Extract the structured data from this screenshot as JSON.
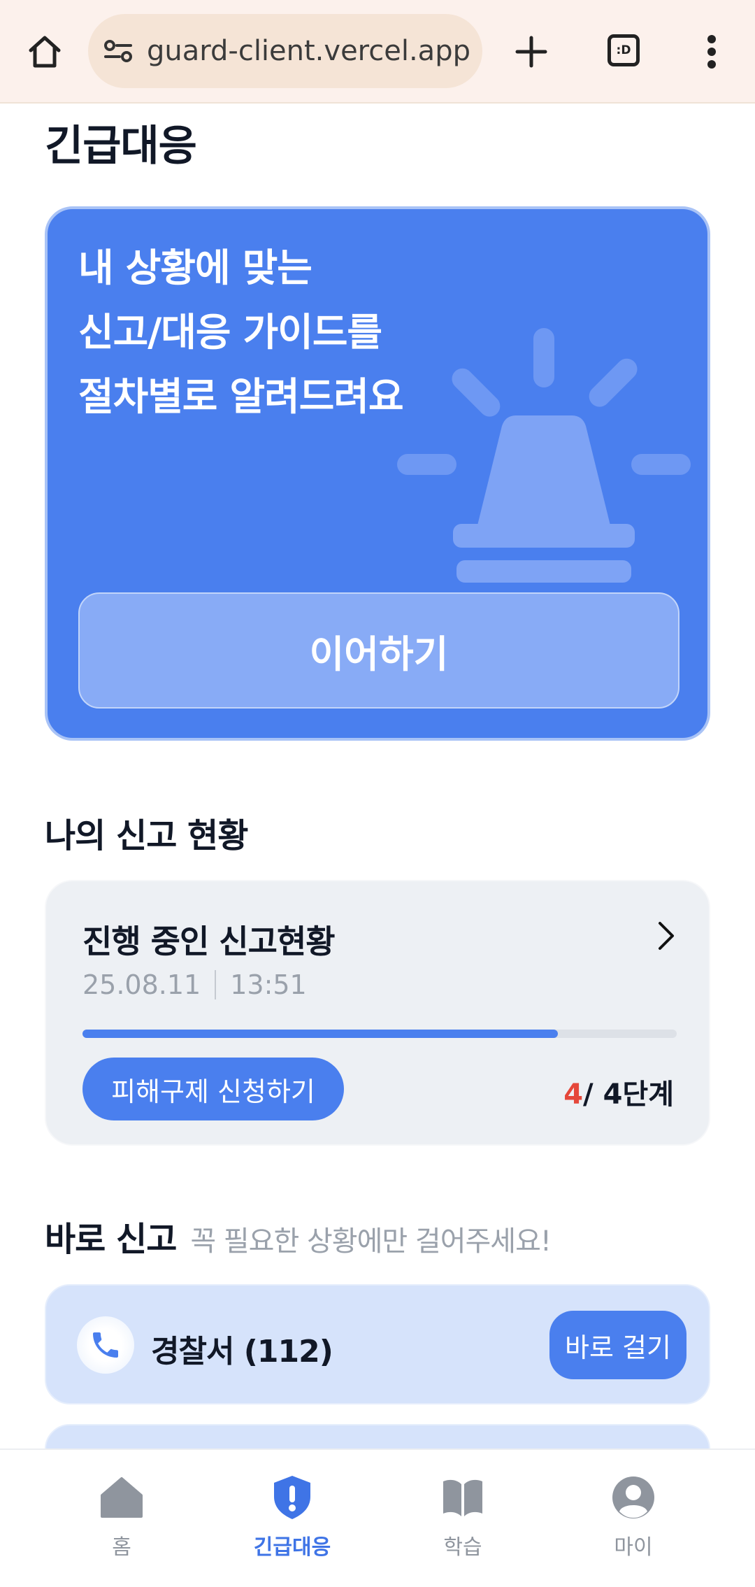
{
  "browser": {
    "url": "guard-client.vercel.app",
    "tab_count": ":D"
  },
  "page": {
    "title": "긴급대응"
  },
  "hero": {
    "line1": "내 상황에 맞는",
    "line2": "신고/대응 가이드를",
    "line3": "절차별로 알려드려요",
    "continue_label": "이어하기",
    "icon": "siren-icon"
  },
  "my_reports": {
    "section_title": "나의 신고 현황",
    "card_title": "진행 중인 신고현황",
    "date": "25.08.11",
    "time": "13:51",
    "progress": 0.8,
    "relief_button": "피해구제 신청하기",
    "step_current": "4",
    "step_total": "/ 4단계"
  },
  "direct_report": {
    "section_title": "바로 신고",
    "subtitle": "꼭 필요한 상황에만 걸어주세요!",
    "items": [
      {
        "label": "경찰서 (112)",
        "button": "바로 걸기",
        "icon": "phone-icon"
      }
    ]
  },
  "bottom_nav": {
    "items": [
      {
        "label": "홈",
        "icon": "home-icon",
        "active": false
      },
      {
        "label": "긴급대응",
        "icon": "shield-alert-icon",
        "active": true
      },
      {
        "label": "학습",
        "icon": "book-icon",
        "active": false
      },
      {
        "label": "마이",
        "icon": "user-icon",
        "active": false
      }
    ]
  },
  "colors": {
    "primary": "#4a7fee",
    "alert": "#e5473a",
    "browser_bg": "#fcf1ec"
  }
}
